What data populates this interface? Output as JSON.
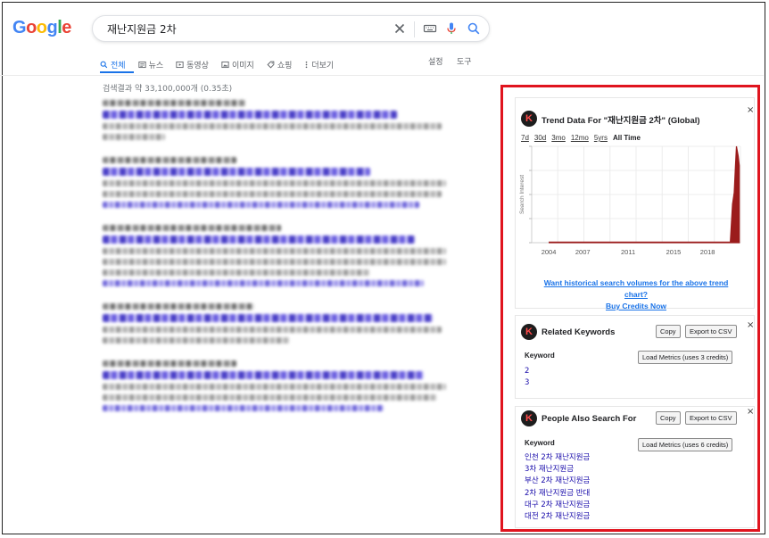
{
  "logo": {
    "letters": [
      "G",
      "o",
      "o",
      "g",
      "l",
      "e"
    ],
    "colors": [
      "#4285f4",
      "#ea4335",
      "#fbbc05",
      "#4285f4",
      "#34a853",
      "#ea4335"
    ]
  },
  "search": {
    "value": "재난지원금 2차"
  },
  "tabs": [
    {
      "label": "전체",
      "icon": "search-icon"
    },
    {
      "label": "뉴스",
      "icon": "news-icon"
    },
    {
      "label": "동영상",
      "icon": "video-icon"
    },
    {
      "label": "이미지",
      "icon": "image-icon"
    },
    {
      "label": "쇼핑",
      "icon": "tag-icon"
    },
    {
      "label": "더보기",
      "icon": "more-vert-icon"
    }
  ],
  "tabs_right": {
    "settings": "설정",
    "tools": "도구"
  },
  "result_stats": "검색결과 약 33,100,000개 (0.35초)",
  "trend": {
    "title": "Trend Data For \"재난지원금 2차\" (Global)",
    "ranges": [
      "7d",
      "30d",
      "3mo",
      "12mo",
      "5yrs",
      "All Time"
    ],
    "selected_range": "All Time",
    "promo_link": "Want historical search volumes for the above trend chart?",
    "buy_link": "Buy Credits Now"
  },
  "chart_data": {
    "type": "area",
    "ylabel": "Search Interest",
    "x_ticks": [
      "2004",
      "2007",
      "2011",
      "2015",
      "2018"
    ],
    "x": [
      2004,
      2005,
      2006,
      2007,
      2008,
      2009,
      2010,
      2011,
      2012,
      2013,
      2014,
      2015,
      2016,
      2017,
      2018,
      2019,
      2020.0,
      2020.2,
      2020.35,
      2020.45,
      2020.55,
      2020.7,
      2020.8
    ],
    "values": [
      0,
      0,
      0,
      0,
      0,
      0,
      0,
      0,
      0,
      0,
      0,
      0,
      0,
      0,
      0,
      0,
      0,
      40,
      52,
      78,
      100,
      90,
      80
    ],
    "ylim": [
      0,
      100
    ],
    "color": "#9b1c1c",
    "grid": true
  },
  "related": {
    "title": "Related Keywords",
    "copy": "Copy",
    "export": "Export to CSV",
    "keyword_header": "Keyword",
    "load": "Load Metrics (uses 3 credits)",
    "items": [
      "2",
      "3"
    ]
  },
  "people": {
    "title": "People Also Search For",
    "copy": "Copy",
    "export": "Export to CSV",
    "keyword_header": "Keyword",
    "load": "Load Metrics (uses 6 credits)",
    "items": [
      "인천 2차 재난지원금",
      "3차 재난지원금",
      "부산 2차 재난지원금",
      "2차 재난지원금 반대",
      "대구 2차 재난지원금",
      "대전 2차 재난지원금"
    ]
  },
  "k_letter": "K",
  "close_symbol": "×",
  "accent": "#e0141e"
}
